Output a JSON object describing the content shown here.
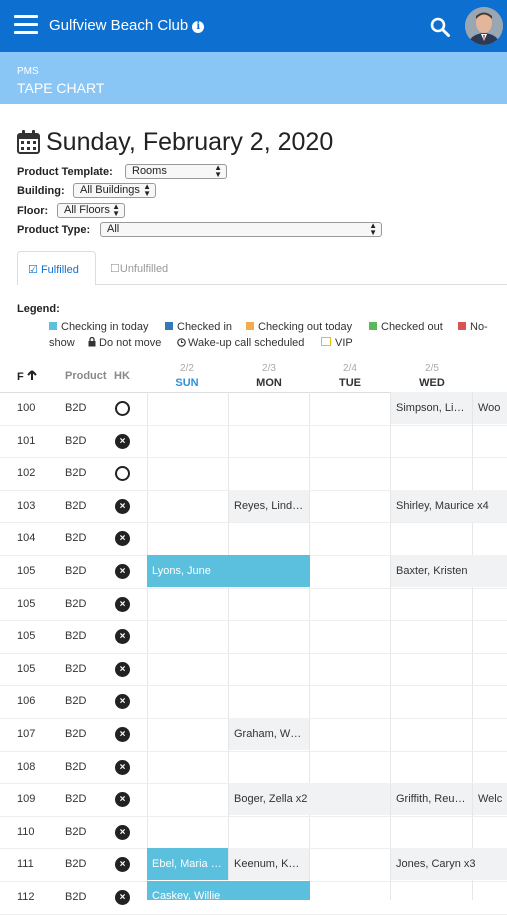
{
  "header": {
    "title": "Gulfview Beach Club"
  },
  "subheader": {
    "section": "PMS",
    "page": "TAPE CHART"
  },
  "date_title": "Sunday, February 2, 2020",
  "filters": {
    "product_template": {
      "label": "Product Template:",
      "value": "Rooms"
    },
    "building": {
      "label": "Building:",
      "value": "All Buildings"
    },
    "floor": {
      "label": "Floor:",
      "value": "All Floors"
    },
    "product_type": {
      "label": "Product Type:",
      "value": "All"
    }
  },
  "tabs": {
    "fulfilled": "Fulfilled",
    "unfulfilled": "Unfulfilled"
  },
  "legend": {
    "title": "Legend:",
    "checking_in": "Checking in today",
    "checked_in": "Checked in",
    "checking_out": "Checking out today",
    "checked_out": "Checked out",
    "no_show_a": "No-",
    "no_show_b": "show",
    "do_not_move": "Do not move",
    "wakeup": "Wake-up call scheduled",
    "vip": "VIP",
    "colors": {
      "checking_in": "#5bc0de",
      "checked_in": "#337ab7",
      "checking_out": "#f0ad4e",
      "checked_out": "#5cb85c",
      "no_show": "#d9534f",
      "vip": "#f5d300"
    }
  },
  "columns": {
    "floor": "F",
    "product": "Product",
    "hk": "HK"
  },
  "days": [
    {
      "date": "2/2",
      "name": "SUN"
    },
    {
      "date": "2/3",
      "name": "MON"
    },
    {
      "date": "2/4",
      "name": "TUE"
    },
    {
      "date": "2/5",
      "name": "WED"
    }
  ],
  "rows": [
    {
      "room": "100",
      "product": "B2D",
      "hk": "clean"
    },
    {
      "room": "101",
      "product": "B2D",
      "hk": "dirty"
    },
    {
      "room": "102",
      "product": "B2D",
      "hk": "clean"
    },
    {
      "room": "103",
      "product": "B2D",
      "hk": "dirty"
    },
    {
      "room": "104",
      "product": "B2D",
      "hk": "dirty"
    },
    {
      "room": "105",
      "product": "B2D",
      "hk": "dirty"
    },
    {
      "room": "105",
      "product": "B2D",
      "hk": "dirty"
    },
    {
      "room": "105",
      "product": "B2D",
      "hk": "dirty"
    },
    {
      "room": "105",
      "product": "B2D",
      "hk": "dirty"
    },
    {
      "room": "106",
      "product": "B2D",
      "hk": "dirty"
    },
    {
      "room": "107",
      "product": "B2D",
      "hk": "dirty"
    },
    {
      "room": "108",
      "product": "B2D",
      "hk": "dirty"
    },
    {
      "room": "109",
      "product": "B2D",
      "hk": "dirty"
    },
    {
      "room": "110",
      "product": "B2D",
      "hk": "dirty"
    },
    {
      "room": "111",
      "product": "B2D",
      "hk": "dirty"
    },
    {
      "room": "112",
      "product": "B2D",
      "hk": "dirty"
    }
  ],
  "reservations": {
    "r0_wed": "Simpson, Li…",
    "r0_thu": "Woo",
    "r3_mon": "Reyes, Lind…",
    "r3_wed": "Shirley, Maurice x4",
    "r5_sun": "Lyons, June",
    "r5_wed": "Baxter, Kristen",
    "r10_mon": "Graham, W…",
    "r12_mon": "Boger, Zella x2",
    "r12_wed": "Griffith, Reu…",
    "r12_thu": "Welc",
    "r14_sun": "Ebel, Maria …",
    "r14_mon": "Keenum, K…",
    "r14_wed": "Jones, Caryn x3",
    "r15_sun": "Caskey, Willie"
  }
}
